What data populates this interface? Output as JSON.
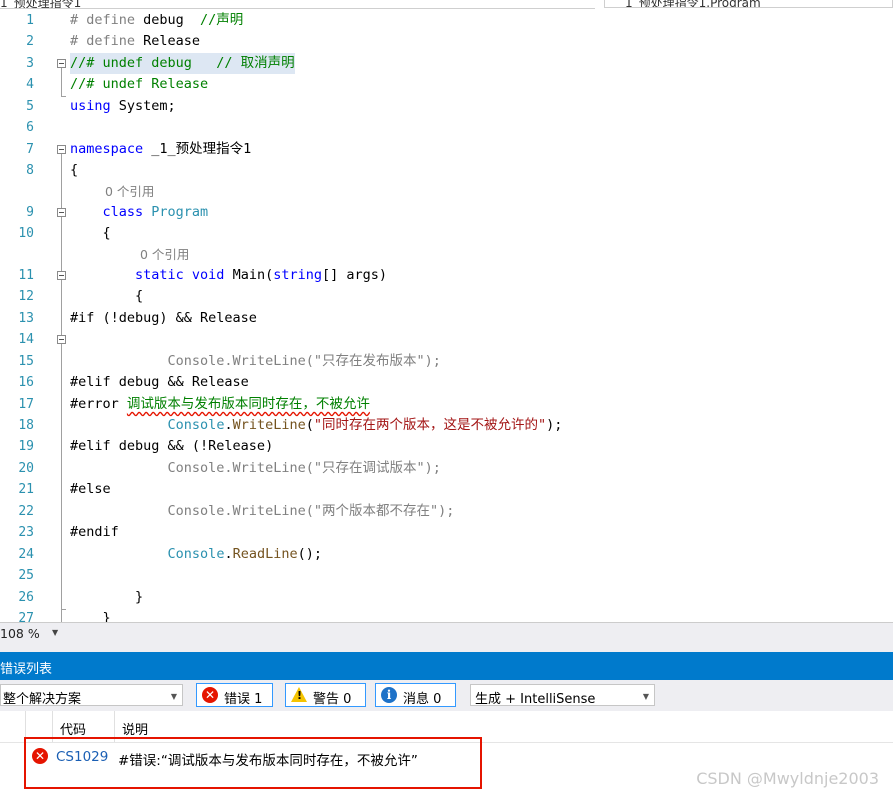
{
  "tabs": {
    "left_label": "1_预处理指令1",
    "right_label": "_1_预处理指令1.Program"
  },
  "editor": {
    "line_numbers": [
      "1",
      "2",
      "3",
      "4",
      "5",
      "6",
      "7",
      "8",
      "9",
      "10",
      "11",
      "12",
      "13",
      "14",
      "15",
      "16",
      "17",
      "18",
      "19",
      "20",
      "21",
      "22",
      "23",
      "24",
      "25",
      "26",
      "27"
    ],
    "code_lens": [
      "0 个引用",
      "0 个引用"
    ],
    "lines": {
      "l1a": "# define ",
      "l1b": "debug",
      "l1c": "  //声明",
      "l2a": "# define ",
      "l2b": "Release",
      "l3": "//# undef debug   // 取消声明",
      "l4": "//# undef Release",
      "l5a": "using",
      "l5b": " System;",
      "l7a": "namespace",
      "l7b": " _1_预处理指令1",
      "l8": "{",
      "l9a": "    class",
      "l9b": " Program",
      "l10": "    {",
      "l11a": "        static",
      "l11b": " void",
      "l11c": " Main(",
      "l11d": "string",
      "l11e": "[] args)",
      "l12": "        {",
      "l13": "#if (!debug) && Release",
      "l15": "            Console.WriteLine(\"只存在发布版本\");",
      "l16": "#elif debug && Release",
      "l17a": "#error ",
      "l17b": "调试版本与发布版本同时存在，不被允许",
      "l18a": "            ",
      "l18b": "Console",
      "l18c": ".",
      "l18d": "WriteLine",
      "l18e": "(",
      "l18f": "\"同时存在两个版本，这是不被允许的\"",
      "l18g": ");",
      "l19": "#elif debug && (!Release)",
      "l20": "            Console.WriteLine(\"只存在调试版本\");",
      "l21": "#else",
      "l22": "            Console.WriteLine(\"两个版本都不存在\");",
      "l23": "#endif",
      "l24a": "            ",
      "l24b": "Console",
      "l24c": ".",
      "l24d": "ReadLine",
      "l24e": "();",
      "l26": "        }",
      "l27": "    }"
    }
  },
  "zoom": {
    "value": "108 %"
  },
  "error_list": {
    "title": "错误列表",
    "scope": "整个解决方案",
    "errors_button": "错误 1",
    "warnings_button": "警告 0",
    "messages_button": "消息 0",
    "build_filter": "生成 + IntelliSense",
    "columns": {
      "code": "代码",
      "description": "说明"
    },
    "rows": [
      {
        "code": "CS1029",
        "description": "#错误:“调试版本与发布版本同时存在，不被允许”"
      }
    ]
  },
  "watermark": "CSDN @Mwyldnje2003",
  "colors": {
    "accent": "#007acc",
    "error": "#e51400",
    "keyword": "#0000ff",
    "type": "#2b91af",
    "comment": "#008000",
    "string": "#a31515"
  }
}
